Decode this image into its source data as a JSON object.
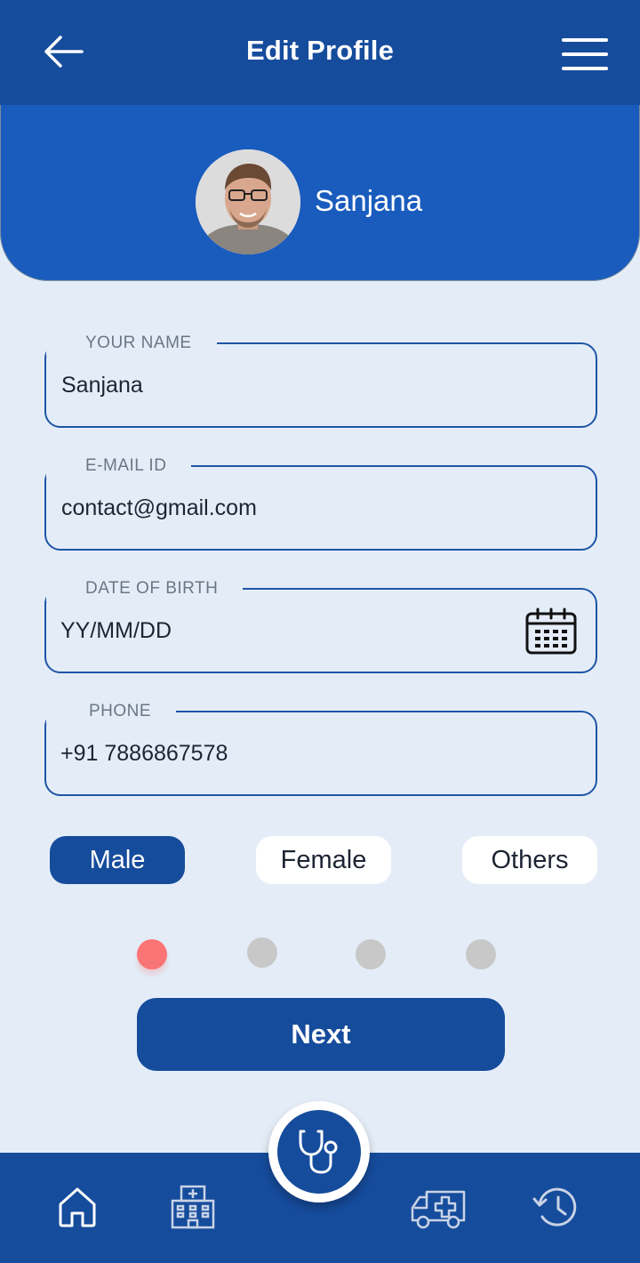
{
  "header": {
    "title": "Edit Profile",
    "back_icon": "arrow-left-icon",
    "menu_icon": "hamburger-menu-icon"
  },
  "profile": {
    "name": "Sanjana",
    "avatar_icon": "avatar"
  },
  "form": {
    "name": {
      "label": "YOUR NAME",
      "value": "Sanjana"
    },
    "email": {
      "label": "E-MAIL ID",
      "value": "contact@gmail.com"
    },
    "dob": {
      "label": "DATE OF BIRTH",
      "value": "YY/MM/DD",
      "icon": "calendar-icon"
    },
    "phone": {
      "label": "PHONE",
      "value": "+91 7886867578"
    }
  },
  "gender": {
    "options": [
      "Male",
      "Female",
      "Others"
    ],
    "selected": "Male"
  },
  "pager": {
    "total": 4,
    "current": 1
  },
  "next_button": {
    "label": "Next"
  },
  "bottom_nav": {
    "items": [
      "home-icon",
      "hospital-icon",
      "stethoscope-icon",
      "ambulance-icon",
      "history-icon"
    ]
  },
  "colors": {
    "primary": "#164c9c",
    "header_band": "#1a5cbd",
    "background": "#e4edf7",
    "active_dot": "#f97475",
    "inactive_dot": "#c8c8c8"
  }
}
